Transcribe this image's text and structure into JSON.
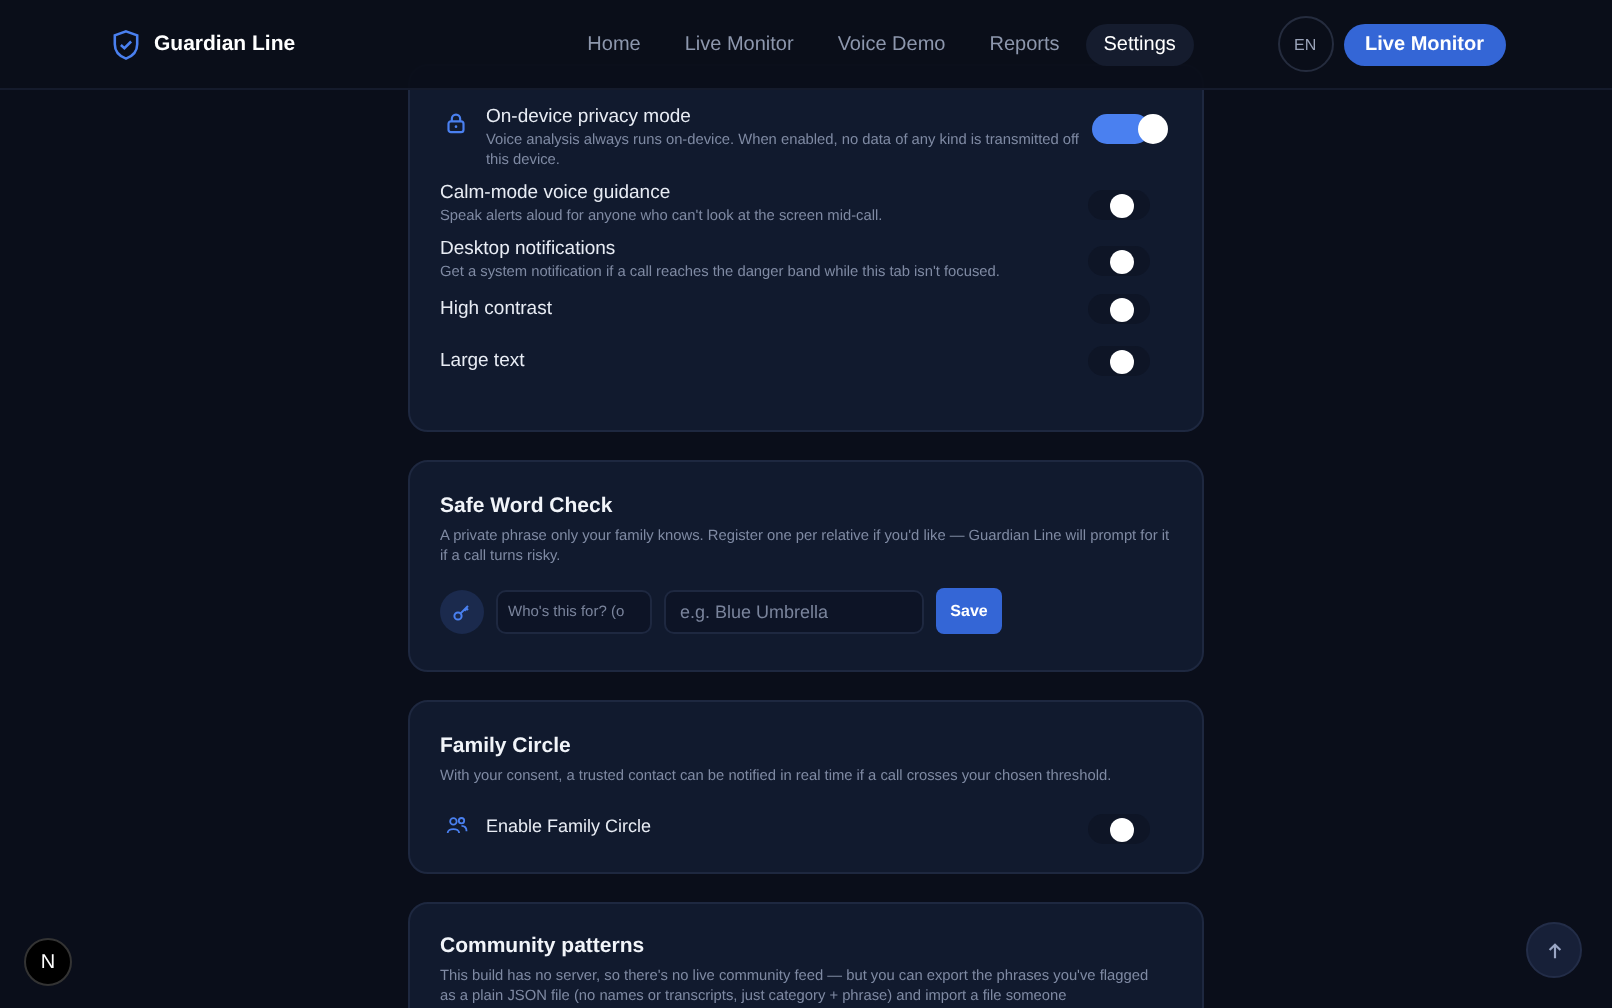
{
  "header": {
    "brand": "Guardian Line",
    "nav": [
      {
        "label": "Home",
        "selected": false
      },
      {
        "label": "Live Monitor",
        "selected": false
      },
      {
        "label": "Voice Demo",
        "selected": false
      },
      {
        "label": "Reports",
        "selected": false
      },
      {
        "label": "Settings",
        "selected": true
      }
    ],
    "language": "EN",
    "cta": "Live Monitor"
  },
  "preferences": [
    {
      "kind": "icon",
      "title": "On-device privacy mode",
      "description": "Voice analysis always runs on-device. When enabled, no data of any kind is transmitted off this device.",
      "on": true
    },
    {
      "kind": "plain",
      "title": "Calm-mode voice guidance",
      "description": "Speak alerts aloud for anyone who can't look at the screen mid-call.",
      "on": false
    },
    {
      "kind": "plain",
      "title": "Desktop notifications",
      "description": "Get a system notification if a call reaches the danger band while this tab isn't focused.",
      "on": false
    },
    {
      "kind": "plain",
      "title": "High contrast",
      "on": false
    },
    {
      "kind": "plain",
      "title": "Large text",
      "on": false
    }
  ],
  "safe_word": {
    "title": "Safe Word Check",
    "description": "A private phrase only your family knows. Register one per relative if you'd like — Guardian Line will prompt for it if a call turns risky.",
    "who_placeholder": "Who's this for? (o",
    "phrase_placeholder": "e.g. Blue Umbrella",
    "save": "Save"
  },
  "family_circle": {
    "title": "Family Circle",
    "description": "With your consent, a trusted contact can be notified in real time if a call crosses your chosen threshold.",
    "toggle_label": "Enable Family Circle",
    "on": false
  },
  "community": {
    "title": "Community patterns",
    "description": "This build has no server, so there's no live community feed — but you can export the phrases you've flagged as a plain JSON file (no names or transcripts, just category + phrase) and import a file someone"
  },
  "badge": "N"
}
